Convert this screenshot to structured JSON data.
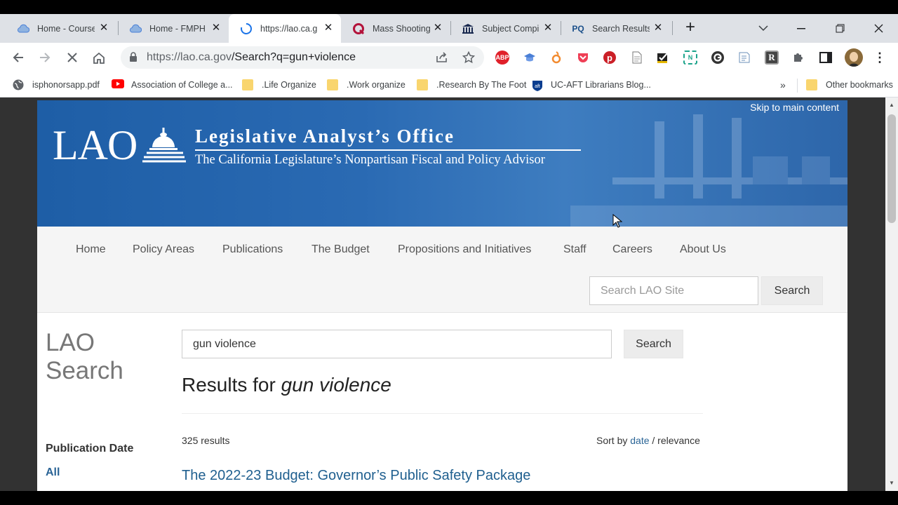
{
  "browser": {
    "tabs": [
      {
        "title": "Home - Course",
        "icon": "cloud-icon",
        "active": false
      },
      {
        "title": "Home - FMPH",
        "icon": "cloud-icon",
        "active": false
      },
      {
        "title": "https://lao.ca.g",
        "icon": "loading-spinner-icon",
        "active": true
      },
      {
        "title": "Mass Shooting",
        "icon": "q-logo-icon",
        "active": false
      },
      {
        "title": "Subject Compi",
        "icon": "library-icon",
        "active": false
      },
      {
        "title": "Search Results",
        "icon": "proquest-icon",
        "active": false
      }
    ],
    "address": {
      "host": "https://lao.ca.gov",
      "path": "/Search?q=gun+violence"
    },
    "bookmarks": [
      {
        "label": "isphonorsapp.pdf",
        "icon": "globe-icon"
      },
      {
        "label": "Association of College a...",
        "icon": "youtube-icon"
      },
      {
        "label": ".Life Organize",
        "icon": "folder-icon"
      },
      {
        "label": ".Work organize",
        "icon": "folder-icon"
      },
      {
        "label": ".Research By The Foot",
        "icon": "folder-icon"
      },
      {
        "label": "UC-AFT Librarians Blog...",
        "icon": "uc-aft-icon"
      }
    ],
    "bookmarks_more": "»",
    "other_bookmarks": "Other bookmarks",
    "extensions": [
      {
        "icon": "adblock-icon",
        "text": "ABP",
        "color": "#e0202a"
      },
      {
        "icon": "mortarboard-icon",
        "text": "",
        "color": "#4a7fd6"
      },
      {
        "icon": "flame-icon",
        "text": "",
        "color": "#f28b30"
      },
      {
        "icon": "pocket-icon",
        "text": "",
        "color": "#ef3f56"
      },
      {
        "icon": "pinterest-icon",
        "text": "",
        "color": "#cb1f27"
      },
      {
        "icon": "page-icon",
        "text": "",
        "color": "#888888"
      },
      {
        "icon": "checkbox-icon",
        "text": "",
        "color": "#222222"
      },
      {
        "icon": "n-icon",
        "text": "N",
        "color": "#1aa38a"
      },
      {
        "icon": "grammarly-icon",
        "text": "",
        "color": "#333333"
      },
      {
        "icon": "note-icon",
        "text": "",
        "color": "#6b8fb8"
      },
      {
        "icon": "r-icon",
        "text": "R",
        "color": "#444444"
      },
      {
        "icon": "puzzle-icon",
        "text": "",
        "color": "#5f6368"
      }
    ]
  },
  "site": {
    "skip_link": "Skip to main content",
    "logo": {
      "lao": "LAO",
      "title": "Legislative Analyst’s Office",
      "subtitle": "The California Legislature’s Nonpartisan Fiscal and Policy Advisor"
    },
    "nav": [
      "Home",
      "Policy Areas",
      "Publications",
      "The Budget",
      "Propositions and Initiatives",
      "Staff",
      "Careers",
      "About Us"
    ],
    "site_search": {
      "placeholder": "Search LAO Site",
      "button": "Search"
    }
  },
  "search_page": {
    "side_title_1": "LAO",
    "side_title_2": "Search",
    "query": "gun violence",
    "button": "Search",
    "results_prefix": "Results for ",
    "results_query": "gun violence",
    "count": "325 results",
    "sort_label": "Sort by ",
    "sort_date": "date",
    "sort_sep": " / ",
    "sort_relevance": "relevance",
    "filter_heading": "Publication Date",
    "filter_all": "All",
    "first_result": "The 2022-23 Budget: Governor’s Public Safety Package"
  },
  "colors": {
    "header_blue": "#2a6ab3",
    "link_blue": "#1f5f8f",
    "tab_strip": "#dee1e6"
  }
}
